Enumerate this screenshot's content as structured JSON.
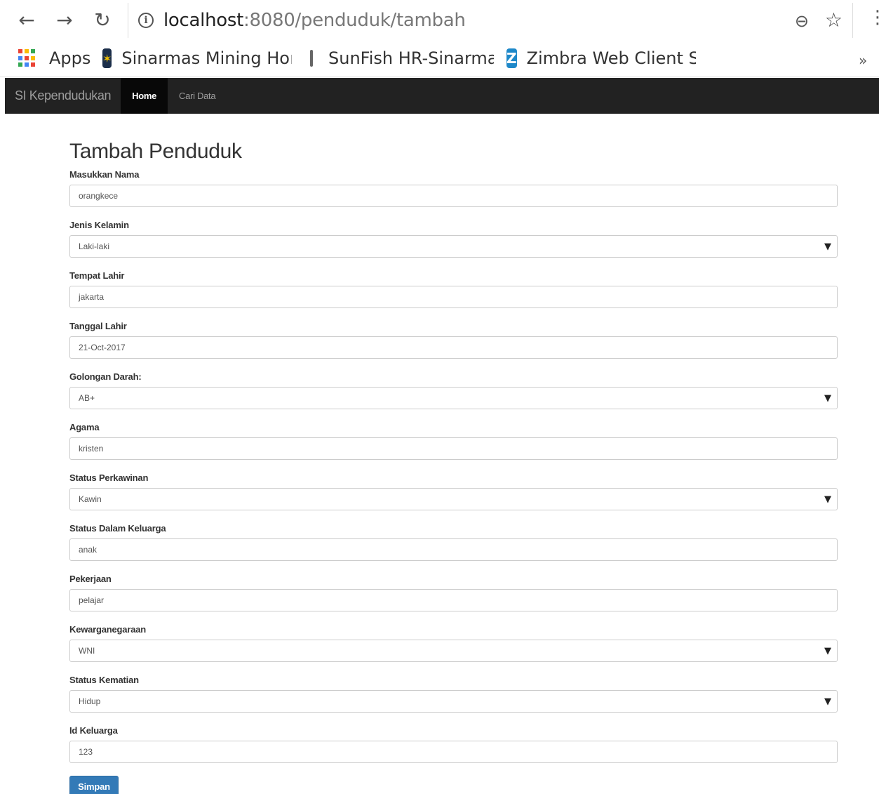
{
  "browser": {
    "url_host": "localhost",
    "url_path": ":8080/penduduk/tambah",
    "bookmarks": [
      {
        "label": "Apps",
        "fade": ""
      },
      {
        "label": "Sinarmas Mining Ho",
        "fade": "n"
      },
      {
        "label": "SunFish HR-Sinarma",
        "fade": "s"
      },
      {
        "label": "Zimbra Web Client S",
        "fade": "i"
      }
    ],
    "more_label": "»"
  },
  "navbar": {
    "brand": "SI Kependudukan",
    "items": [
      {
        "label": "Home",
        "active": true
      },
      {
        "label": "Cari Data",
        "active": false
      }
    ]
  },
  "form": {
    "title": "Tambah Penduduk",
    "fields": [
      {
        "label": "Masukkan Nama",
        "value": "orangkece",
        "type": "input"
      },
      {
        "label": "Jenis Kelamin",
        "value": "Laki-laki",
        "type": "select"
      },
      {
        "label": "Tempat Lahir",
        "value": "jakarta",
        "type": "input"
      },
      {
        "label": "Tanggal Lahir",
        "value": "21-Oct-2017",
        "type": "input"
      },
      {
        "label": "Golongan Darah:",
        "value": "AB+",
        "type": "select"
      },
      {
        "label": "Agama",
        "value": "kristen",
        "type": "input"
      },
      {
        "label": "Status Perkawinan",
        "value": "Kawin",
        "type": "select"
      },
      {
        "label": "Status Dalam Keluarga",
        "value": "anak",
        "type": "input"
      },
      {
        "label": "Pekerjaan",
        "value": "pelajar",
        "type": "input"
      },
      {
        "label": "Kewarganegaraan",
        "value": "WNI",
        "type": "select"
      },
      {
        "label": "Status Kematian",
        "value": "Hidup",
        "type": "select"
      },
      {
        "label": "Id Keluarga",
        "value": "123",
        "type": "input"
      }
    ],
    "submit_label": "Simpan"
  },
  "icons": {
    "back": "back-arrow-icon",
    "forward": "forward-arrow-icon",
    "reload": "reload-icon",
    "info": "info-icon",
    "zoom": "zoom-out-icon",
    "star": "bookmark-star-icon",
    "menu": "menu-icon",
    "caret": "chevron-down-icon"
  },
  "colors": {
    "navbar_bg": "#222222",
    "navbar_active_bg": "#080808",
    "primary_button": "#337ab7"
  }
}
